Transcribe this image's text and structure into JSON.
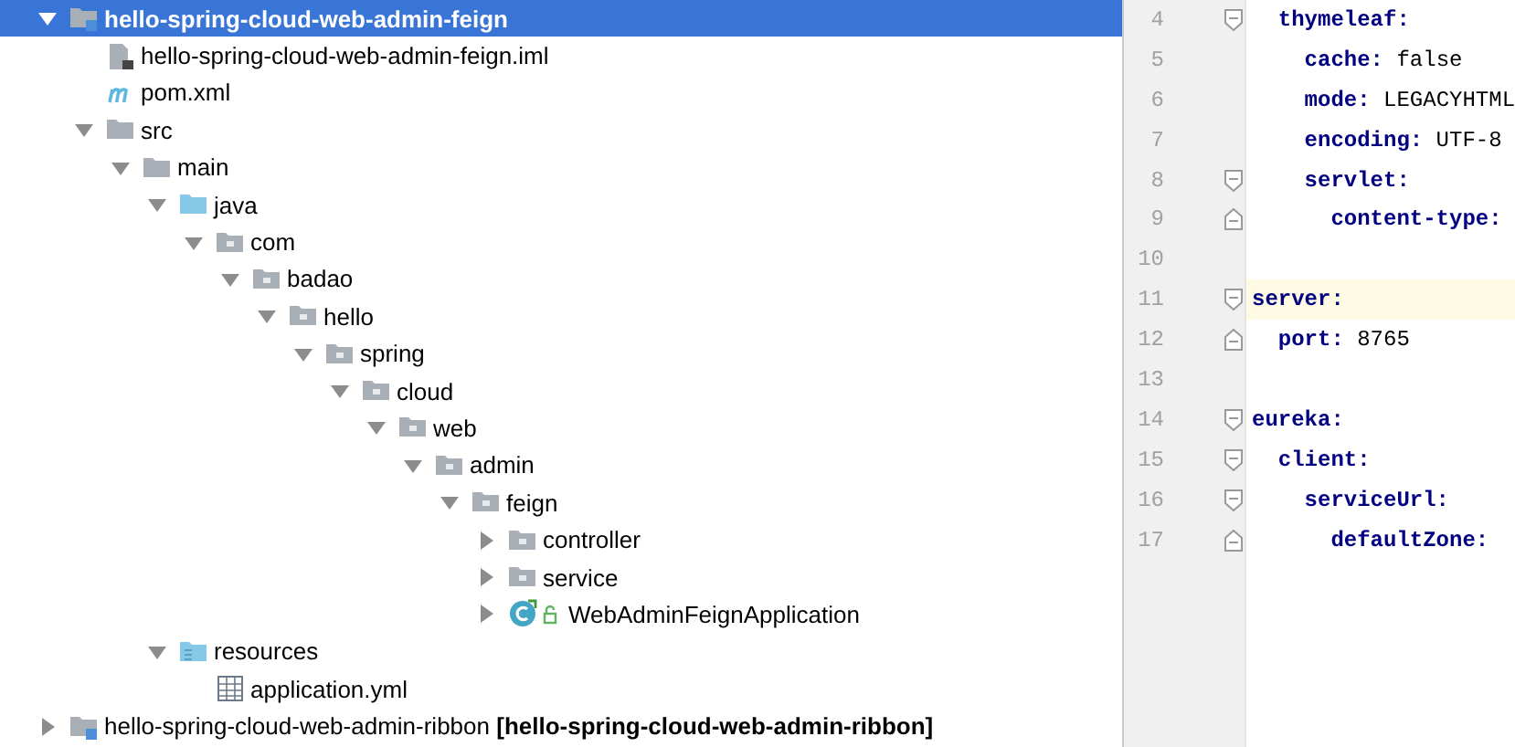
{
  "project_tree": [
    {
      "label": "hello-spring-cloud-web-admin-feign",
      "kind": "module",
      "bold": true,
      "selected": true,
      "expanded": true,
      "children": [
        {
          "label": "hello-spring-cloud-web-admin-feign.iml",
          "kind": "iml",
          "selected": false
        },
        {
          "label": "pom.xml",
          "kind": "maven",
          "selected": false
        },
        {
          "label": "src",
          "kind": "folder",
          "selected": false,
          "expanded": true,
          "children": [
            {
              "label": "main",
              "kind": "folder",
              "selected": false,
              "expanded": true,
              "children": [
                {
                  "label": "java",
                  "kind": "source",
                  "selected": false,
                  "expanded": true,
                  "children": [
                    {
                      "label": "com",
                      "kind": "package",
                      "selected": false,
                      "expanded": true,
                      "children": [
                        {
                          "label": "badao",
                          "kind": "package",
                          "selected": false,
                          "expanded": true,
                          "children": [
                            {
                              "label": "hello",
                              "kind": "package",
                              "selected": false,
                              "expanded": true,
                              "children": [
                                {
                                  "label": "spring",
                                  "kind": "package",
                                  "selected": false,
                                  "expanded": true,
                                  "children": [
                                    {
                                      "label": "cloud",
                                      "kind": "package",
                                      "selected": false,
                                      "expanded": true,
                                      "children": [
                                        {
                                          "label": "web",
                                          "kind": "package",
                                          "selected": false,
                                          "expanded": true,
                                          "children": [
                                            {
                                              "label": "admin",
                                              "kind": "package",
                                              "selected": false,
                                              "expanded": true,
                                              "children": [
                                                {
                                                  "label": "feign",
                                                  "kind": "package",
                                                  "selected": false,
                                                  "expanded": true,
                                                  "children": [
                                                    {
                                                      "label": "controller",
                                                      "kind": "package",
                                                      "selected": false,
                                                      "expanded": false
                                                    },
                                                    {
                                                      "label": "service",
                                                      "kind": "package",
                                                      "selected": false,
                                                      "expanded": false
                                                    },
                                                    {
                                                      "label": "WebAdminFeignApplication",
                                                      "kind": "class",
                                                      "selected": false,
                                                      "expanded": false
                                                    }
                                                  ]
                                                }
                                              ]
                                            }
                                          ]
                                        }
                                      ]
                                    }
                                  ]
                                }
                              ]
                            }
                          ]
                        }
                      ]
                    }
                  ]
                },
                {
                  "label": "resources",
                  "kind": "resource",
                  "selected": false,
                  "expanded": true,
                  "children": [
                    {
                      "label": "application.yml",
                      "kind": "yml",
                      "selected": false
                    }
                  ]
                }
              ]
            }
          ]
        }
      ]
    },
    {
      "label": "hello-spring-cloud-web-admin-ribbon **[hello-spring-cloud-web-admin-ribbon]**",
      "kind": "module",
      "bold": false,
      "selected": false,
      "expanded": false
    }
  ],
  "editor": {
    "lines": [
      {
        "number": "4",
        "code": "  **thymeleaf:**",
        "fold_start": true,
        "fold_end": false,
        "current": false
      },
      {
        "number": "5",
        "code": "    **cache:** false",
        "fold_start": false,
        "fold_end": false,
        "current": false
      },
      {
        "number": "6",
        "code": "    **mode:** LEGACYHTML",
        "fold_start": false,
        "fold_end": false,
        "current": false
      },
      {
        "number": "7",
        "code": "    **encoding:** UTF-8",
        "fold_start": false,
        "fold_end": false,
        "current": false
      },
      {
        "number": "8",
        "code": "    **servlet:**",
        "fold_start": true,
        "fold_end": false,
        "current": false
      },
      {
        "number": "9",
        "code": "      **content-type:**",
        "fold_start": false,
        "fold_end": true,
        "current": false
      },
      {
        "number": "10",
        "fold_start": false,
        "fold_end": false,
        "current": false
      },
      {
        "number": "11",
        "code": "**server:**",
        "fold_start": true,
        "fold_end": false,
        "current": true
      },
      {
        "number": "12",
        "code": "  **port:** 8765",
        "fold_start": false,
        "fold_end": true,
        "current": false
      },
      {
        "number": "13",
        "fold_start": false,
        "fold_end": false,
        "current": false
      },
      {
        "number": "14",
        "code": "**eureka:**",
        "fold_start": true,
        "fold_end": false,
        "current": false
      },
      {
        "number": "15",
        "code": "  **client:**",
        "fold_start": true,
        "fold_end": false,
        "current": false
      },
      {
        "number": "16",
        "code": "    **serviceUrl:**",
        "fold_start": true,
        "fold_end": false,
        "current": false
      },
      {
        "number": "17",
        "code": "      **defaultZone:**",
        "fold_start": false,
        "fold_end": true,
        "current": false
      }
    ]
  }
}
